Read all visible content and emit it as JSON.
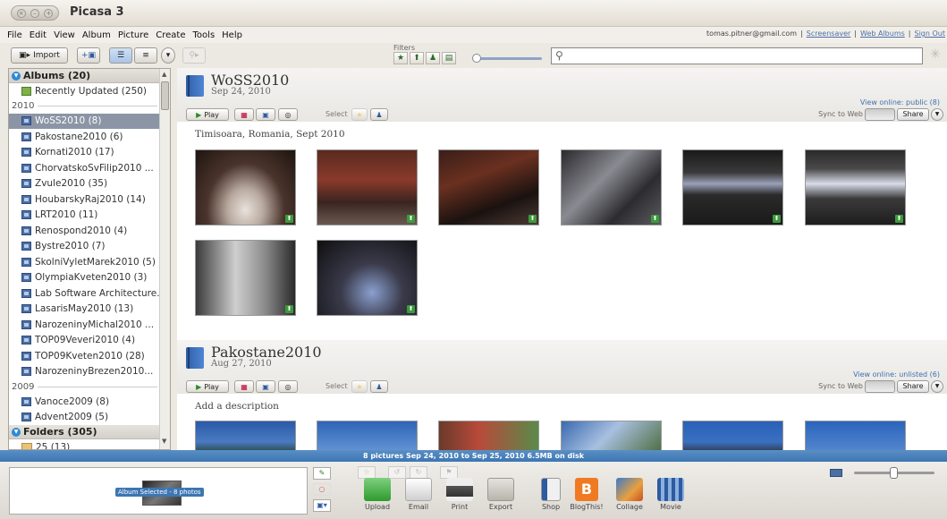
{
  "app": {
    "title": "Picasa 3"
  },
  "menu": [
    "File",
    "Edit",
    "View",
    "Album",
    "Picture",
    "Create",
    "Tools",
    "Help"
  ],
  "account": {
    "email": "tomas.pitner@gmail.com",
    "links": [
      "Screensaver",
      "Web Albums",
      "Sign Out"
    ],
    "sep": "|"
  },
  "toolbar": {
    "import_label": "Import"
  },
  "filters": {
    "label": "Filters"
  },
  "sidebar": {
    "albums_header": "Albums (20)",
    "recently_updated": "Recently Updated (250)",
    "year_2010": "2010",
    "items_2010": [
      "WoSS2010 (8)",
      "Pakostane2010 (6)",
      "Kornati2010 (17)",
      "ChorvatskoSvFilip2010 ...",
      "Zvule2010 (35)",
      "HoubarskyRaj2010 (14)",
      "LRT2010 (11)",
      "Renospond2010 (4)",
      "Bystre2010 (7)",
      "SkolniVyletMarek2010 (5)",
      "OlympiaKveten2010 (3)",
      "Lab Software Architecture...",
      "LasarisMay2010 (13)",
      "NarozeninyMichal2010 ...",
      "TOP09Veveri2010 (4)",
      "TOP09Kveten2010 (28)",
      "NarozeninyBrezen2010..."
    ],
    "year_2009": "2009",
    "items_2009": [
      "Vanoce2009 (8)",
      "Advent2009 (5)"
    ],
    "folders_header": "Folders (305)",
    "folder_item": "25 (13)"
  },
  "albums": [
    {
      "title": "WoSS2010",
      "date": "Sep 24, 2010",
      "view_online": "View online: public (8)",
      "play": "Play",
      "select": "Select",
      "sync": "Sync to Web",
      "share": "Share",
      "description": "Timisoara, Romania, Sept 2010"
    },
    {
      "title": "Pakostane2010",
      "date": "Aug 27, 2010",
      "view_online": "View online: unlisted (6)",
      "play": "Play",
      "select": "Select",
      "sync": "Sync to Web",
      "share": "Share",
      "description": "Add a description"
    }
  ],
  "status": {
    "text": "8 pictures   Sep 24, 2010 to Sep 25, 2010   6.5MB on disk"
  },
  "tray": {
    "label": "Album Selected - 8 photos"
  },
  "actions": [
    "Upload",
    "Email",
    "Print",
    "Export",
    "Shop",
    "BlogThis!",
    "Collage",
    "Movie"
  ]
}
